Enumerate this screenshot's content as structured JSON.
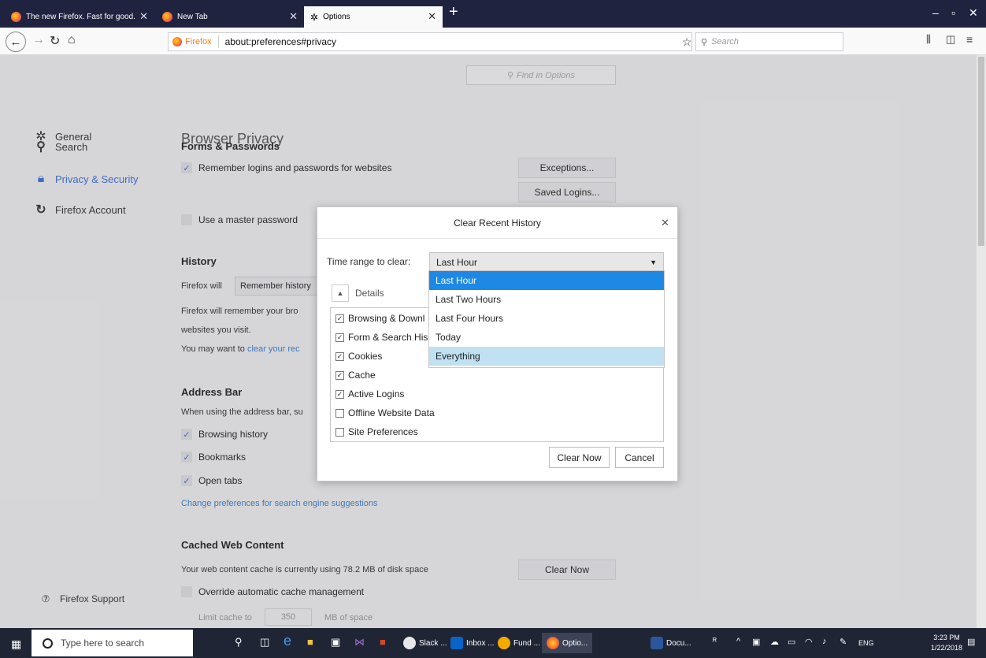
{
  "tabs": [
    {
      "title": "The new Firefox. Fast for good."
    },
    {
      "title": "New Tab"
    },
    {
      "title": "Options"
    }
  ],
  "urlbar": {
    "brand": "Firefox",
    "url": "about:preferences#privacy"
  },
  "searchbar": {
    "placeholder": "Search"
  },
  "find": {
    "placeholder": "Find in Options"
  },
  "sidebar": {
    "items": [
      {
        "label": "General",
        "icon": "gear-icon"
      },
      {
        "label": "Search",
        "icon": "search-icon"
      },
      {
        "label": "Privacy & Security",
        "icon": "lock-icon"
      },
      {
        "label": "Firefox Account",
        "icon": "sync-icon"
      }
    ],
    "support": "Firefox Support"
  },
  "content": {
    "title": "Browser Privacy",
    "forms_heading": "Forms & Passwords",
    "remember_logins": "Remember logins and passwords for websites",
    "exceptions": "Exceptions...",
    "saved_logins": "Saved Logins...",
    "master_password": "Use a master password",
    "history_heading": "History",
    "firefox_will": "Firefox will",
    "remember_history": "Remember history",
    "history_desc1": "Firefox will remember your bro",
    "history_desc2": "websites you visit.",
    "may_want": "You may want to",
    "clear_link": "clear your rec",
    "address_heading": "Address Bar",
    "address_desc": "When using the address bar, su",
    "browsing_history": "Browsing history",
    "bookmarks": "Bookmarks",
    "open_tabs": "Open tabs",
    "change_prefs": "Change preferences for search engine suggestions",
    "cache_heading": "Cached Web Content",
    "cache_desc": "Your web content cache is currently using 78.2 MB of disk space",
    "clear_now": "Clear Now",
    "override": "Override automatic cache management",
    "limit_to": "Limit cache to",
    "limit_value": "350",
    "mb_space": "MB of space"
  },
  "dialog": {
    "title": "Clear Recent History",
    "time_range_label": "Time range to clear:",
    "selected": "Last Hour",
    "options": [
      "Last Hour",
      "Last Two Hours",
      "Last Four Hours",
      "Today",
      "Everything"
    ],
    "details": "Details",
    "items": [
      {
        "label": "Browsing & Downl",
        "checked": true
      },
      {
        "label": "Form & Search His",
        "checked": true
      },
      {
        "label": "Cookies",
        "checked": true
      },
      {
        "label": "Cache",
        "checked": true
      },
      {
        "label": "Active Logins",
        "checked": true
      },
      {
        "label": "Offline Website Data",
        "checked": false
      },
      {
        "label": "Site Preferences",
        "checked": false
      }
    ],
    "clear_now": "Clear Now",
    "cancel": "Cancel"
  },
  "taskbar": {
    "search": "Type here to search",
    "apps": [
      "Slack ...",
      "Inbox ...",
      "Fund ...",
      "Optio...",
      "Docu..."
    ],
    "lang": "ENG",
    "time": "3:23 PM",
    "date": "1/22/2018"
  },
  "colors": {
    "accent": "#3a6fd9",
    "selected_option": "#1e88e5",
    "hover_option": "#bfe1f2",
    "tabstrip": "#202340"
  }
}
